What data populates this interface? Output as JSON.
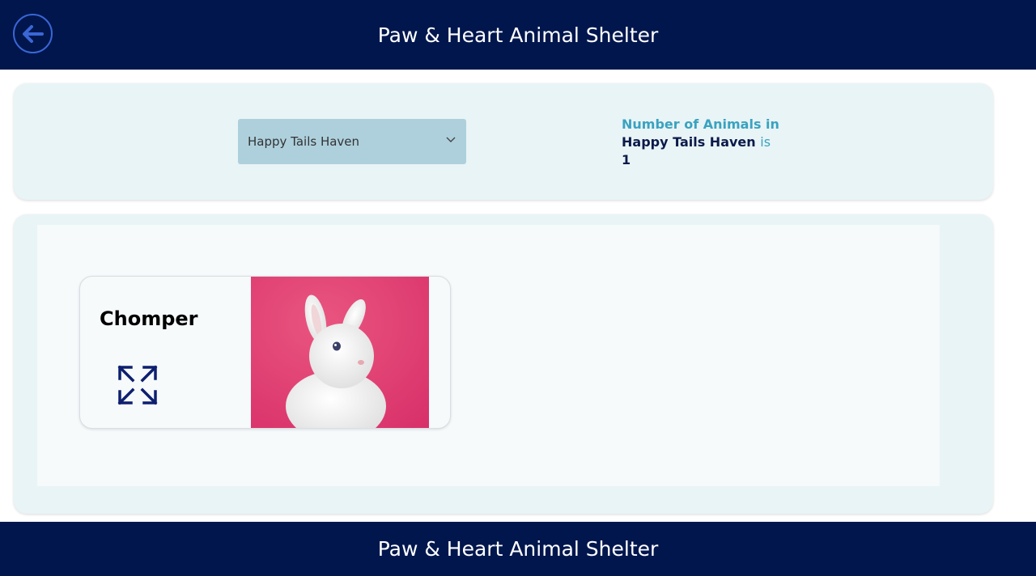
{
  "header": {
    "title": "Paw & Heart Animal Shelter",
    "back_icon": "arrow-left-icon"
  },
  "filter": {
    "shelter_select": {
      "selected": "Happy Tails Haven",
      "icon": "chevron-down-icon"
    },
    "count": {
      "prefix": "Number of Animals in",
      "shelter": "Happy Tails Haven",
      "connector": "is",
      "value": "1"
    }
  },
  "gallery": {
    "animals": [
      {
        "name": "Chomper",
        "expand_icon": "expand-arrows-icon",
        "photo": "white-rabbit-on-pink-photo"
      }
    ]
  },
  "footer": {
    "title": "Paw & Heart Animal Shelter"
  },
  "colors": {
    "nav_bg": "#00164d",
    "panel_bg": "#e9f4f6",
    "dropdown_bg": "#aed0dd",
    "accent_teal": "#3aa2c0",
    "accent_navy": "#0b1a4a",
    "photo_bg": "#e03e72"
  }
}
